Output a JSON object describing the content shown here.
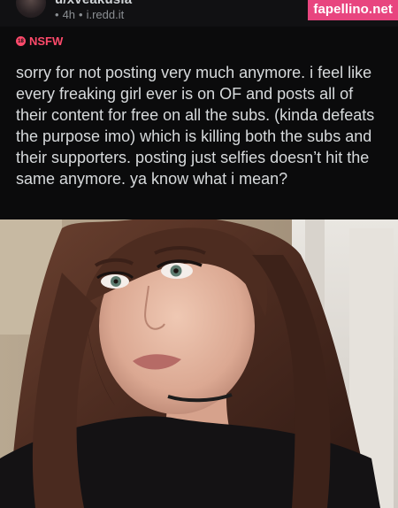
{
  "post": {
    "username": "u/xveakusia",
    "age": "4h",
    "separator": "•",
    "domain": "i.redd.it",
    "nsfw_label": "NSFW",
    "nsfw_icon_text": "18",
    "body": "sorry for not posting very much anymore. i feel like every freaking girl ever is on OF and posts all of their content for free on all the subs. (kinda defeats the purpose imo) which is killing both the subs and their supporters. posting just selfies doesn’t hit the same anymore. ya know what i mean?"
  },
  "watermark": {
    "text": "fapellino.net"
  },
  "colors": {
    "background": "#0b0b0c",
    "text": "#d7dadc",
    "meta": "#8b8f93",
    "nsfw": "#ff4a6b",
    "watermark_bg": "#e8457f"
  },
  "icons": {
    "avatar": "user-avatar",
    "nsfw": "nsfw-18-icon"
  }
}
